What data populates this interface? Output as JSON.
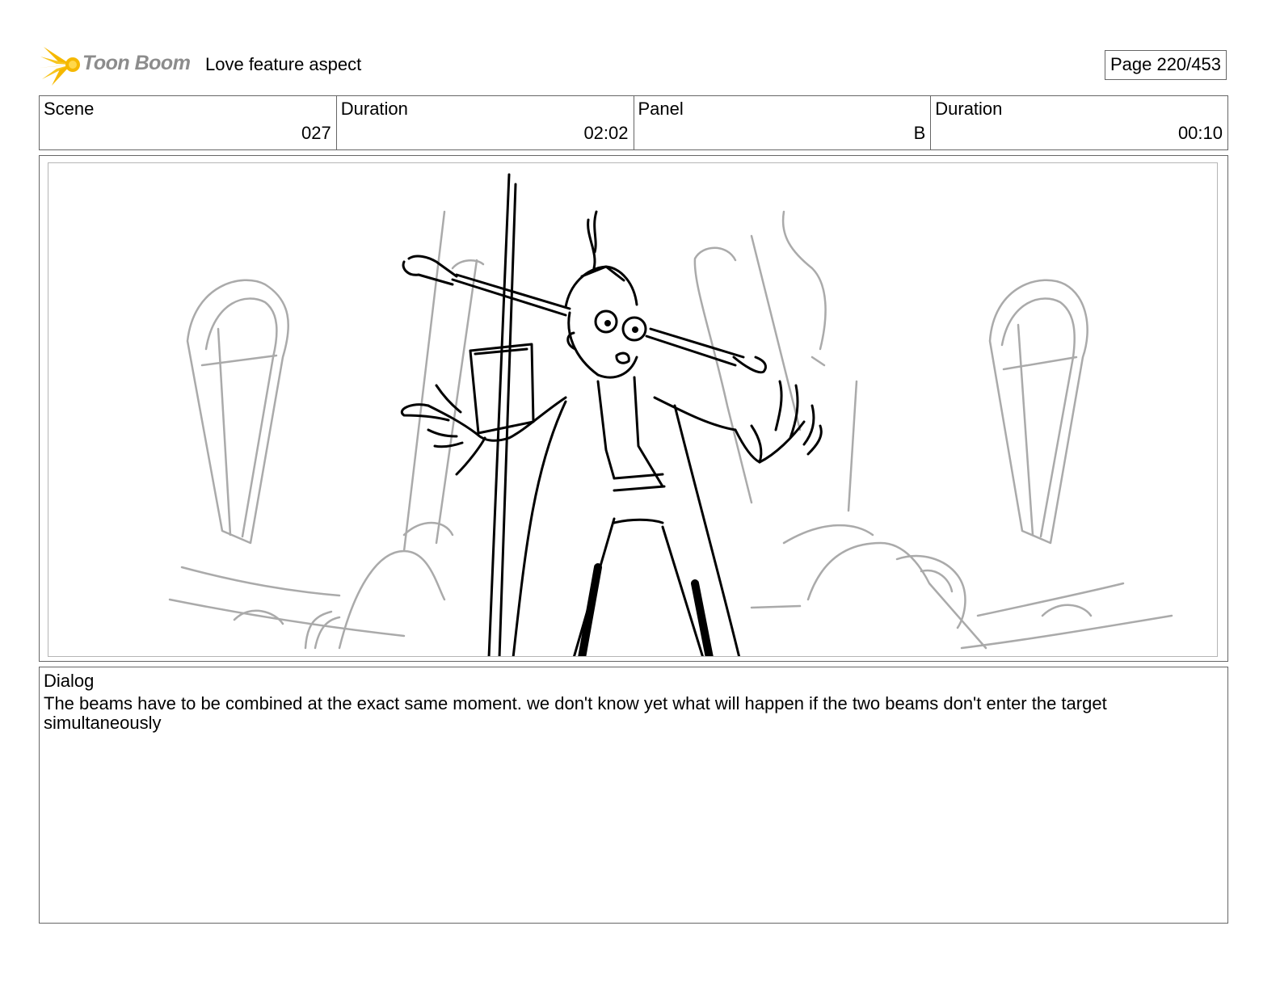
{
  "header": {
    "logo_text": "Toon Boom",
    "project_title": "Love feature aspect",
    "page_label": "Page 220/453"
  },
  "info": {
    "scene_label": "Scene",
    "scene_value": "027",
    "scene_duration_label": "Duration",
    "scene_duration_value": "02:02",
    "panel_label": "Panel",
    "panel_value": "B",
    "panel_duration_label": "Duration",
    "panel_duration_value": "00:10"
  },
  "dialog": {
    "label": "Dialog",
    "text": "The beams have to be combined at the exact same moment. we don't know yet what will happen if the two beams don't enter the target simultaneously"
  },
  "colors": {
    "logo_accent": "#f5b800",
    "border": "#666666",
    "sketch_line": "#000000",
    "background_sketch": "#aaaaaa"
  }
}
